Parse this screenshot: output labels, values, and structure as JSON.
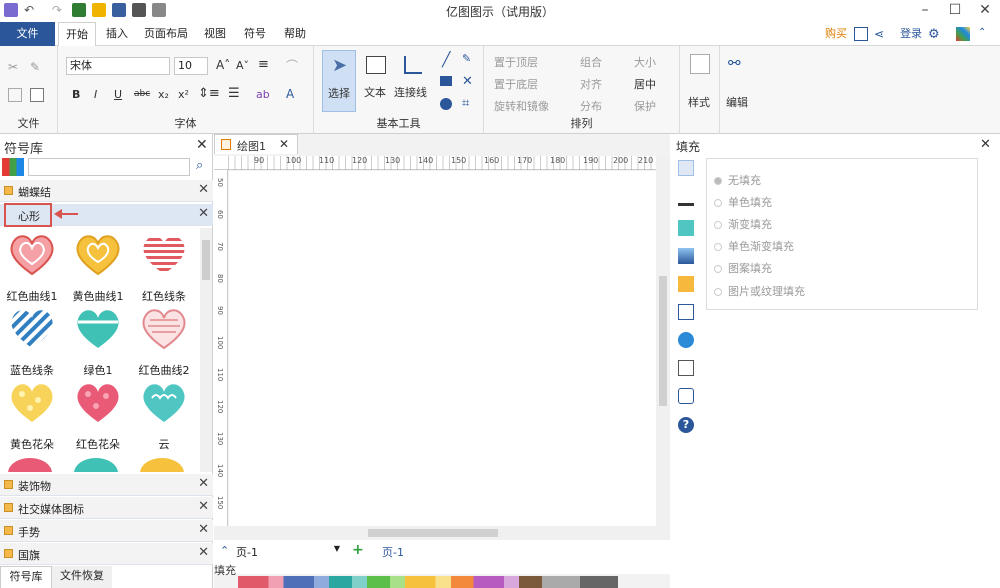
{
  "window": {
    "title": "亿图图示（试用版）"
  },
  "menubar": {
    "file": "文件",
    "tabs": [
      "开始",
      "插入",
      "页面布局",
      "视图",
      "符号",
      "帮助"
    ],
    "buy": "购买",
    "login": "登录"
  },
  "ribbon": {
    "font_name": "宋体",
    "font_size": "10",
    "groups": {
      "file": "文件",
      "font": "字体",
      "basic_tools": "基本工具",
      "arrange": "排列",
      "style": "样式",
      "edit": "编辑"
    },
    "tools": {
      "select": "选择",
      "text": "文本",
      "connector": "连接线"
    },
    "arrange_items": [
      "置于顶层",
      "置于底层",
      "旋转和镜像",
      "组合",
      "对齐",
      "分布",
      "大小",
      "居中",
      "保护"
    ]
  },
  "left_panel": {
    "title": "符号库",
    "categories_top": [
      "蝴蝶结",
      "心形"
    ],
    "symbols": [
      "红色曲线1",
      "黄色曲线1",
      "红色线条",
      "蓝色线条",
      "绿色1",
      "红色曲线2",
      "黄色花朵",
      "红色花朵",
      "云"
    ],
    "categories_bottom": [
      "装饰物",
      "社交媒体图标",
      "手势",
      "国旗"
    ],
    "tabs": [
      "符号库",
      "文件恢复"
    ]
  },
  "canvas": {
    "doc_tab": "绘图1",
    "ruler_top": [
      "90",
      "100",
      "110",
      "120",
      "130",
      "140",
      "150",
      "160",
      "170",
      "180",
      "190",
      "200",
      "210"
    ],
    "ruler_left": [
      "50",
      "60",
      "70",
      "80",
      "90",
      "100",
      "110",
      "120",
      "130",
      "140",
      "150"
    ],
    "page_select": "页-1",
    "page_tab": "页-1",
    "fill_label": "填充"
  },
  "right_panel": {
    "title": "填充",
    "options": [
      "无填充",
      "单色填充",
      "渐变填充",
      "单色渐变填充",
      "图案填充",
      "图片或纹理填充"
    ]
  },
  "colors": {
    "ribbon_blue": "#2b579a",
    "highlight": "#d9534f",
    "panel_bg": "#f7f7f7"
  }
}
